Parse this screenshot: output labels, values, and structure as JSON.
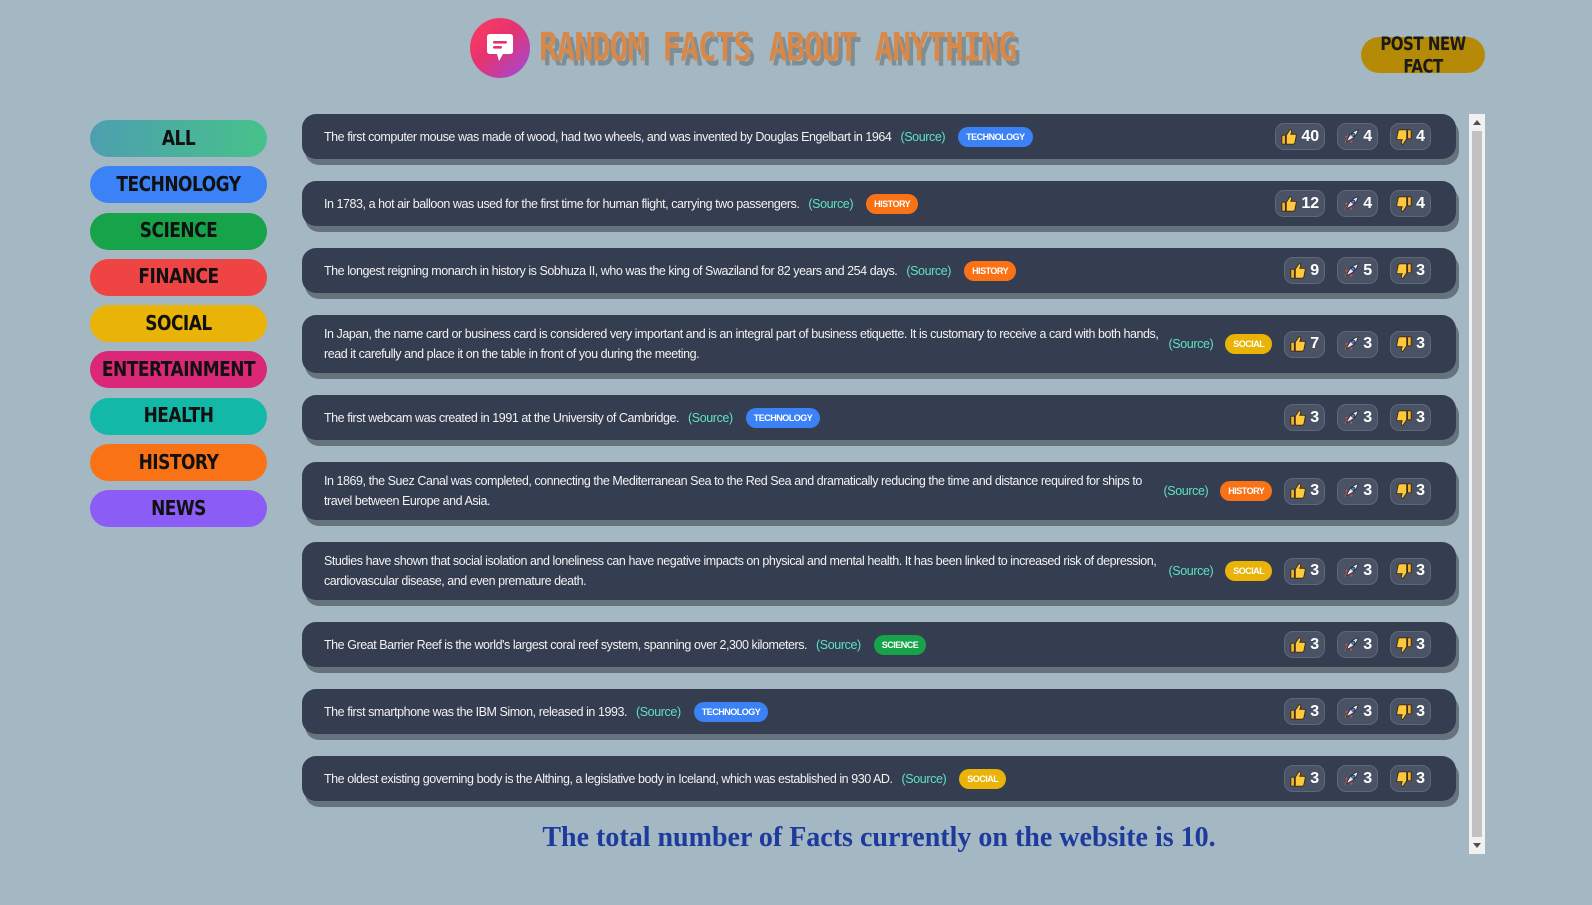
{
  "header": {
    "title": "RANDOM FACTS ABOUT ANYTHING",
    "post_button": "POST NEW FACT"
  },
  "categories": [
    {
      "label": "ALL",
      "color": "#4ab0a0"
    },
    {
      "label": "TECHNOLOGY",
      "color": "#3b82f6"
    },
    {
      "label": "SCIENCE",
      "color": "#16a34a"
    },
    {
      "label": "FINANCE",
      "color": "#ef4444"
    },
    {
      "label": "SOCIAL",
      "color": "#eab308"
    },
    {
      "label": "ENTERTAINMENT",
      "color": "#db2777"
    },
    {
      "label": "HEALTH",
      "color": "#14b8a6"
    },
    {
      "label": "HISTORY",
      "color": "#f97316"
    },
    {
      "label": "NEWS",
      "color": "#8b5cf6"
    }
  ],
  "source_label": "(Source)",
  "facts": [
    {
      "text": "The first computer mouse was made of wood, had two wheels, and was invented by Douglas Engelbart in 1964",
      "tag": "TECHNOLOGY",
      "tag_color": "#3b82f6",
      "likes": "40",
      "mindblowing": "4",
      "false": "4"
    },
    {
      "text": "In 1783, a hot air balloon was used for the first time for human flight, carrying two passengers.",
      "tag": "HISTORY",
      "tag_color": "#f97316",
      "likes": "12",
      "mindblowing": "4",
      "false": "4"
    },
    {
      "text": "The longest reigning monarch in history is Sobhuza II, who was the king of Swaziland for 82 years and 254 days.",
      "tag": "HISTORY",
      "tag_color": "#f97316",
      "likes": "9",
      "mindblowing": "5",
      "false": "3"
    },
    {
      "text": "In Japan, the name card or business card is considered very important and is an integral part of business etiquette. It is customary to receive a card with both hands, read it carefully and place it on the table in front of you during the meeting.",
      "tag": "SOCIAL",
      "tag_color": "#eab308",
      "likes": "7",
      "mindblowing": "3",
      "false": "3"
    },
    {
      "text": "The first webcam was created in 1991 at the University of Cambridge.",
      "tag": "TECHNOLOGY",
      "tag_color": "#3b82f6",
      "likes": "3",
      "mindblowing": "3",
      "false": "3"
    },
    {
      "text": "In 1869, the Suez Canal was completed, connecting the Mediterranean Sea to the Red Sea and dramatically reducing the time and distance required for ships to travel between Europe and Asia.",
      "tag": "HISTORY",
      "tag_color": "#f97316",
      "likes": "3",
      "mindblowing": "3",
      "false": "3"
    },
    {
      "text": "Studies have shown that social isolation and loneliness can have negative impacts on physical and mental health. It has been linked to increased risk of depression, cardiovascular disease, and even premature death.",
      "tag": "SOCIAL",
      "tag_color": "#eab308",
      "likes": "3",
      "mindblowing": "3",
      "false": "3"
    },
    {
      "text": "The Great Barrier Reef is the world's largest coral reef system, spanning over 2,300 kilometers.",
      "tag": "SCIENCE",
      "tag_color": "#16a34a",
      "likes": "3",
      "mindblowing": "3",
      "false": "3"
    },
    {
      "text": "The first smartphone was the IBM Simon, released in 1993.",
      "tag": "TECHNOLOGY",
      "tag_color": "#3b82f6",
      "likes": "3",
      "mindblowing": "3",
      "false": "3"
    },
    {
      "text": "The oldest existing governing body is the Althing, a legislative body in Iceland, which was established in 930 AD.",
      "tag": "SOCIAL",
      "tag_color": "#eab308",
      "likes": "3",
      "mindblowing": "3",
      "false": "3"
    }
  ],
  "footer": {
    "total_text": "The total number of Facts currently on the website is 10."
  }
}
